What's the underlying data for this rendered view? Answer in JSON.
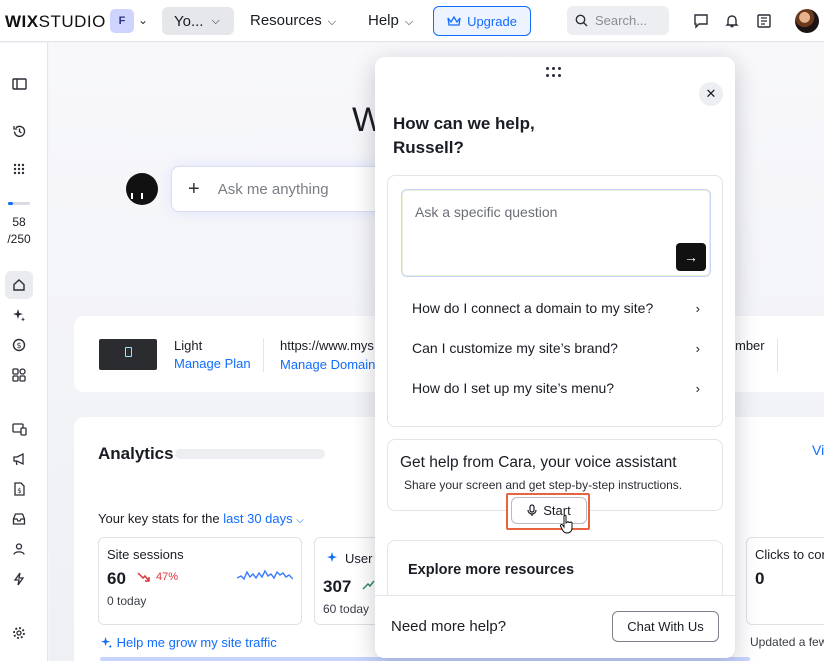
{
  "topbar": {
    "logo_wix": "WIX",
    "logo_studio": "STUDIO",
    "workspace_initial": "F",
    "site_label": "Yo...",
    "nav": [
      "Resources",
      "Help"
    ],
    "upgrade_label": "Upgrade",
    "search_placeholder": "Search..."
  },
  "sidebar": {
    "count_used": "58",
    "count_total": "/250",
    "progress_fraction": 0.23
  },
  "main": {
    "welcome_text": "W",
    "ask_placeholder": "Ask me anything",
    "plan_name": "Light",
    "manage_plan": "Manage Plan",
    "domain_url": "https://www.mys",
    "manage_domain": "Manage Domain",
    "member_partial": "mber",
    "analytics_title": "Analytics",
    "view_partial": "Vi",
    "stats_prefix": "Your key stats for the",
    "stats_range": "last 30 days",
    "stats": [
      {
        "title": "Site sessions",
        "value": "60",
        "change": "47%",
        "today": "0 today"
      },
      {
        "title": "User",
        "value": "307",
        "today": "60 today"
      },
      {
        "title": "Clicks to cor",
        "value": "0"
      }
    ],
    "help_grow": "Help me grow my site traffic",
    "updated": "Updated a few"
  },
  "panel": {
    "greeting_line1": "How can we help,",
    "greeting_line2": "Russell?",
    "question_placeholder": "Ask a specific question",
    "suggestions": [
      "How do I connect a domain to my site?",
      "Can I customize my site’s brand?",
      "How do I set up my site’s menu?"
    ],
    "cara_title": "Get help from Cara, your voice assistant",
    "cara_sub": "Share your screen and get step-by-step instructions.",
    "start_label": "Start",
    "explore_title": "Explore more resources",
    "need_help": "Need more help?",
    "chat_label": "Chat With Us"
  },
  "colors": {
    "accent": "#116dff",
    "highlight": "#e8643f",
    "negative": "#e0323a",
    "positive": "#2c8a5a"
  }
}
